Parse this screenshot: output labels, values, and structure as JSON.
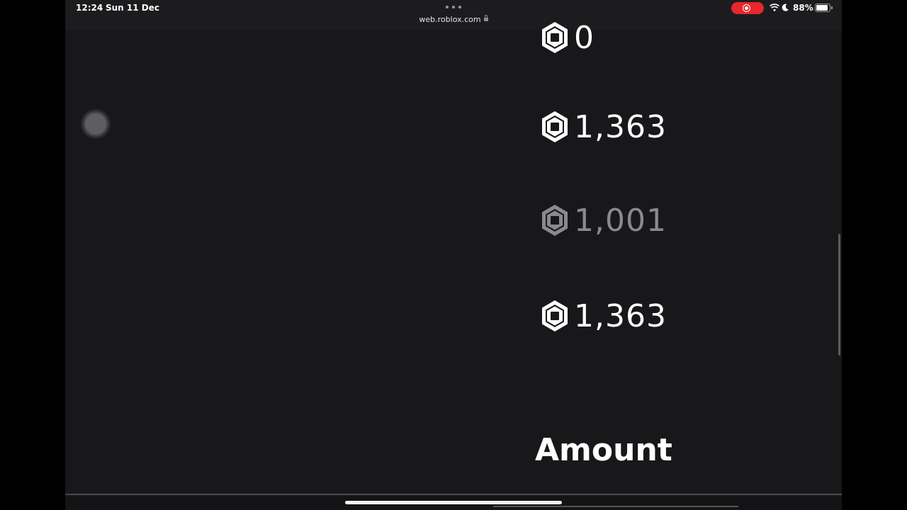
{
  "status_bar": {
    "time": "12:24",
    "date": "Sun 11 Dec",
    "url": "web.roblox.com",
    "battery_percent_label": "88%",
    "battery_level": 0.88,
    "recording_color": "#e8262d"
  },
  "robux_amounts": [
    {
      "value": "0",
      "state": "normal"
    },
    {
      "value": "1,363",
      "state": "normal"
    },
    {
      "value": "1,001",
      "state": "dimmed"
    },
    {
      "value": "1,363",
      "state": "normal"
    }
  ],
  "amount_heading": "Amount",
  "icons": {
    "robux": "robux-icon",
    "assistive_touch": "assistive-touch-button",
    "lock": "lock-icon",
    "wifi": "wifi-icon",
    "moon": "moon-icon",
    "battery": "battery-icon",
    "record": "record-icon"
  }
}
